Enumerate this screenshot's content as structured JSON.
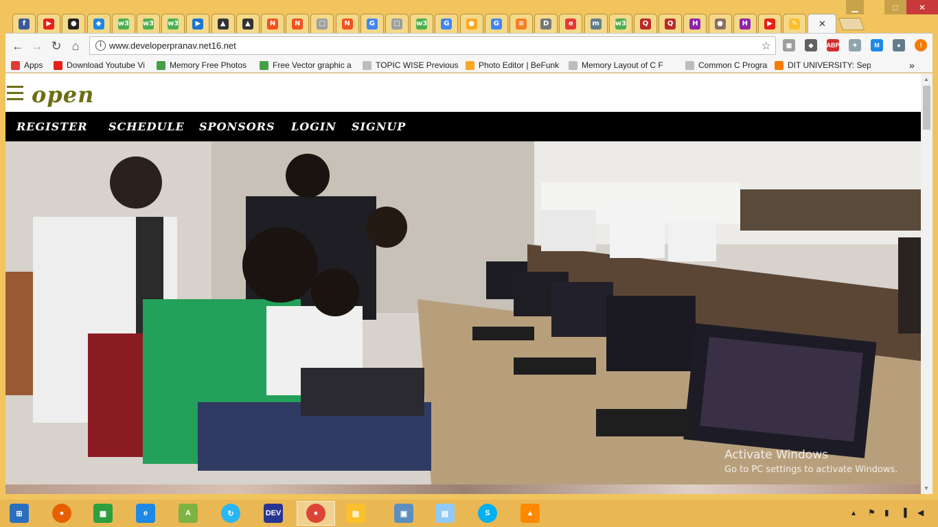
{
  "window": {
    "minimize_glyph": "▁",
    "maximize_glyph": "□",
    "close_glyph": "✕"
  },
  "tabs": [
    {
      "icon": "facebook-icon",
      "color": "#3b5998",
      "glyph": "f"
    },
    {
      "icon": "youtube-icon",
      "color": "#e62117",
      "glyph": "▶"
    },
    {
      "icon": "github-icon",
      "color": "#222222",
      "glyph": "●"
    },
    {
      "icon": "google-drive-icon",
      "color": "#1e88e5",
      "glyph": "◆"
    },
    {
      "icon": "w3schools-icon",
      "color": "#4caf50",
      "glyph": "w3"
    },
    {
      "icon": "w3schools-icon",
      "color": "#4caf50",
      "glyph": "w3"
    },
    {
      "icon": "w3schools-icon",
      "color": "#4caf50",
      "glyph": "w3"
    },
    {
      "icon": "play-icon",
      "color": "#1976d2",
      "glyph": "▶"
    },
    {
      "icon": "wolf-icon",
      "color": "#333333",
      "glyph": "▲"
    },
    {
      "icon": "wolf-icon",
      "color": "#333333",
      "glyph": "▲"
    },
    {
      "icon": "n-icon",
      "color": "#f4511e",
      "glyph": "N"
    },
    {
      "icon": "n-icon",
      "color": "#f4511e",
      "glyph": "N"
    },
    {
      "icon": "page-icon",
      "color": "#9e9e9e",
      "glyph": "□"
    },
    {
      "icon": "n-icon",
      "color": "#f4511e",
      "glyph": "N"
    },
    {
      "icon": "google-icon",
      "color": "#4285f4",
      "glyph": "G"
    },
    {
      "icon": "page-icon",
      "color": "#9e9e9e",
      "glyph": "□"
    },
    {
      "icon": "w3schools-icon",
      "color": "#4caf50",
      "glyph": "w3"
    },
    {
      "icon": "google-icon",
      "color": "#4285f4",
      "glyph": "G"
    },
    {
      "icon": "befunky-icon",
      "color": "#f9a825",
      "glyph": "●"
    },
    {
      "icon": "google-icon",
      "color": "#4285f4",
      "glyph": "G"
    },
    {
      "icon": "stackoverflow-icon",
      "color": "#f48024",
      "glyph": "≡"
    },
    {
      "icon": "dit-icon",
      "color": "#777777",
      "glyph": "D"
    },
    {
      "icon": "edge-icon",
      "color": "#e53935",
      "glyph": "e"
    },
    {
      "icon": "m-icon",
      "color": "#607d8b",
      "glyph": "m"
    },
    {
      "icon": "w3schools-icon",
      "color": "#4caf50",
      "glyph": "w3"
    },
    {
      "icon": "quora-icon",
      "color": "#b92b27",
      "glyph": "Q"
    },
    {
      "icon": "quora-icon",
      "color": "#b92b27",
      "glyph": "Q"
    },
    {
      "icon": "hackerrank-icon",
      "color": "#8e24aa",
      "glyph": "H"
    },
    {
      "icon": "owl-icon",
      "color": "#8d6e63",
      "glyph": "●"
    },
    {
      "icon": "hackerrank-icon",
      "color": "#8e24aa",
      "glyph": "H"
    },
    {
      "icon": "youtube-icon",
      "color": "#e62117",
      "glyph": "▶"
    },
    {
      "icon": "pen-icon",
      "color": "#fbc02d",
      "glyph": "✎"
    }
  ],
  "toolbar": {
    "url": "www.developerpranav.net16.net",
    "back_glyph": "←",
    "forward_glyph": "→",
    "reload_glyph": "↻",
    "home_glyph": "⌂",
    "info_glyph": "i",
    "star_glyph": "☆",
    "extensions": [
      {
        "icon": "extension-icon",
        "color": "#9e9e9e",
        "glyph": "▣"
      },
      {
        "icon": "extension-icon",
        "color": "#616161",
        "glyph": "◆"
      },
      {
        "icon": "adblock-icon",
        "color": "#d32f2f",
        "glyph": "ABP"
      },
      {
        "icon": "extension-icon",
        "color": "#90a4ae",
        "glyph": "✦"
      },
      {
        "icon": "gmail-icon",
        "color": "#1e88e5",
        "glyph": "M"
      },
      {
        "icon": "extension-icon",
        "color": "#607d8b",
        "glyph": "●"
      },
      {
        "icon": "alert-icon",
        "color": "#f57c00",
        "glyph": "!"
      }
    ]
  },
  "bookmarks": [
    {
      "label": "Apps",
      "icon": "apps-icon",
      "color": "#e53935"
    },
    {
      "label": "Download Youtube Vi",
      "icon": "youtube-icon",
      "color": "#e62117"
    },
    {
      "label": "Memory Free Photos",
      "icon": "download-icon",
      "color": "#43a047"
    },
    {
      "label": "Free Vector graphic a",
      "icon": "download-icon",
      "color": "#43a047"
    },
    {
      "label": "TOPIC WISE Previous",
      "icon": "page-icon",
      "color": "#bdbdbd"
    },
    {
      "label": "Photo Editor | BeFunk",
      "icon": "befunky-icon",
      "color": "#f9a825"
    },
    {
      "label": "Memory Layout of C F",
      "icon": "page-icon",
      "color": "#bdbdbd"
    },
    {
      "label": "Common C Programm",
      "icon": "page-icon",
      "color": "#bdbdbd"
    },
    {
      "label": "DIT UNIVERSITY: Sept",
      "icon": "blogger-icon",
      "color": "#f57c00"
    }
  ],
  "bookmarks_overflow": "»",
  "site": {
    "logo": "open",
    "nav": [
      "REGISTER",
      "SCHEDULE",
      "SPONSORS",
      "LOGIN",
      "SIGNUP"
    ]
  },
  "watermark": {
    "title": "Activate Windows",
    "subtitle": "Go to PC settings to activate Windows."
  },
  "taskbar": {
    "apps": [
      {
        "icon": "windows-start-icon",
        "color": "#2a6fbf",
        "glyph": "⊞"
      },
      {
        "icon": "firefox-icon",
        "color": "#e66000",
        "glyph": "●"
      },
      {
        "icon": "store-icon",
        "color": "#2e9e3e",
        "glyph": "▦"
      },
      {
        "icon": "internet-explorer-icon",
        "color": "#1e88e5",
        "glyph": "e"
      },
      {
        "icon": "android-studio-icon",
        "color": "#7cb342",
        "glyph": "A"
      },
      {
        "icon": "sync-icon",
        "color": "#29b6f6",
        "glyph": "↻"
      },
      {
        "icon": "devcpp-icon",
        "color": "#283593",
        "glyph": "DEV"
      },
      {
        "icon": "chrome-icon",
        "color": "#db4437",
        "glyph": "●"
      },
      {
        "icon": "file-explorer-icon",
        "color": "#fbc02d",
        "glyph": "▤"
      },
      {
        "icon": "photos-icon",
        "color": "#5c8fbf",
        "glyph": "▣"
      },
      {
        "icon": "notepad-icon",
        "color": "#90caf9",
        "glyph": "▤"
      },
      {
        "icon": "skype-icon",
        "color": "#00aff0",
        "glyph": "S"
      },
      {
        "icon": "vlc-icon",
        "color": "#ff8800",
        "glyph": "▲"
      }
    ],
    "tray": [
      "▴",
      "⚑",
      "▮",
      "▐",
      "◀"
    ]
  }
}
